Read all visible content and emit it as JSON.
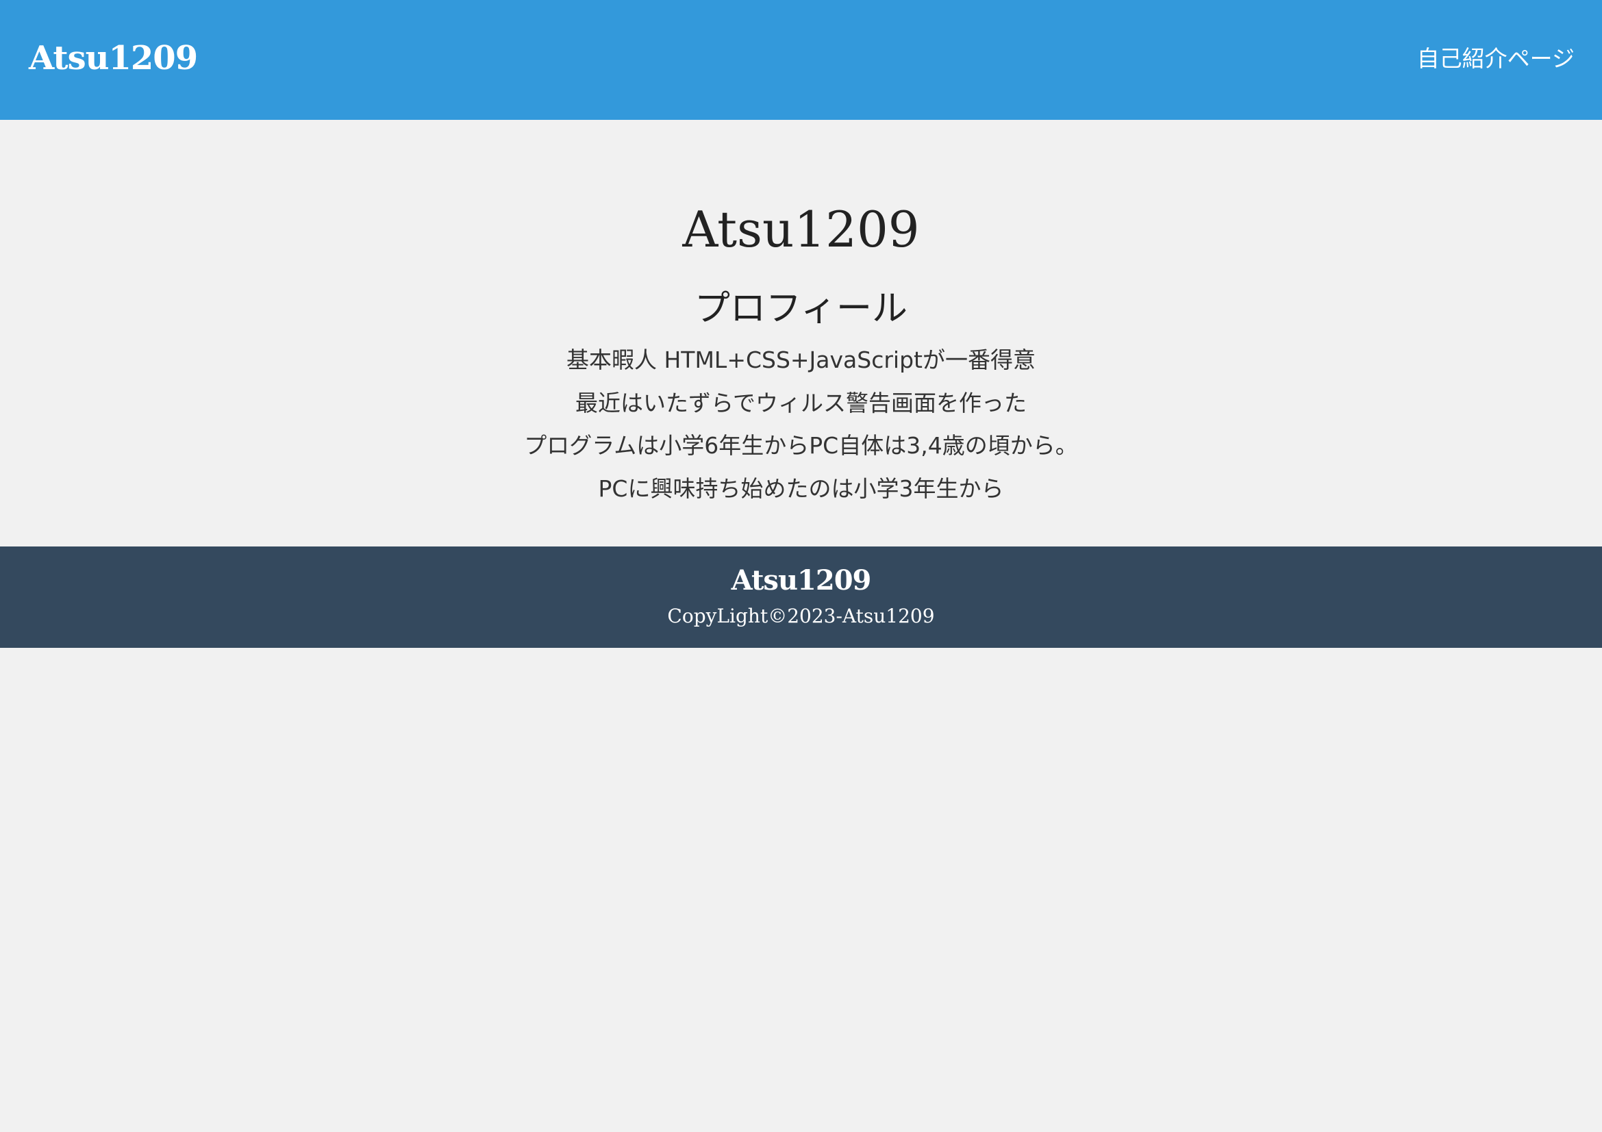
{
  "header": {
    "logo": "Atsu1209",
    "nav_link": "自己紹介ページ",
    "background_color": "#3399db"
  },
  "main": {
    "title": "Atsu1209",
    "section_title": "プロフィール",
    "lines": [
      "基本暇人 HTML+CSS+JavaScriptが一番得意",
      "最近はいたずらでウィルス警告画面を作った",
      "プログラムは小学6年生からPC自体は3,4歳の頃から。",
      "PCに興味持ち始めたのは小学3年生から"
    ],
    "background_color": "#f1f1f1"
  },
  "footer": {
    "brand": "Atsu1209",
    "copyright": "CopyLight©2023-Atsu1209",
    "background_color": "#34495e"
  }
}
